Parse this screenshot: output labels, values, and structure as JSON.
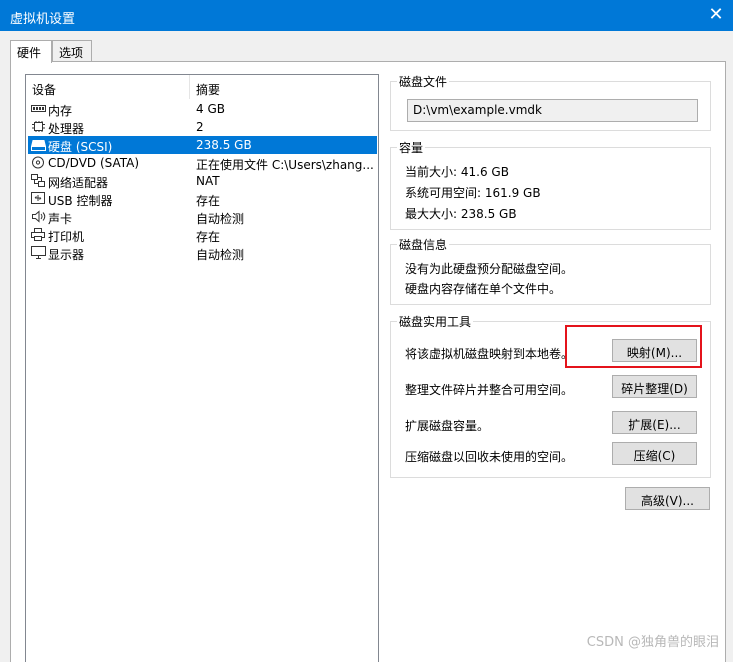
{
  "window": {
    "title": "虚拟机设置",
    "close_glyph": "✕"
  },
  "tabs": [
    {
      "label": "硬件",
      "active": true
    },
    {
      "label": "选项",
      "active": false
    }
  ],
  "device_list": {
    "col_device": "设备",
    "col_summary": "摘要",
    "rows": [
      {
        "name": "内存",
        "summary": "4 GB",
        "icon": "memory-icon"
      },
      {
        "name": "处理器",
        "summary": "2",
        "icon": "cpu-icon"
      },
      {
        "name": "硬盘 (SCSI)",
        "summary": "238.5 GB",
        "icon": "hard-disk-icon",
        "selected": true
      },
      {
        "name": "CD/DVD (SATA)",
        "summary": "正在使用文件 C:\\Users\\zhang...",
        "icon": "cd-dvd-icon"
      },
      {
        "name": "网络适配器",
        "summary": "NAT",
        "icon": "network-adapter-icon"
      },
      {
        "name": "USB 控制器",
        "summary": "存在",
        "icon": "usb-icon"
      },
      {
        "name": "声卡",
        "summary": "自动检测",
        "icon": "speaker-icon"
      },
      {
        "name": "打印机",
        "summary": "存在",
        "icon": "printer-icon"
      },
      {
        "name": "显示器",
        "summary": "自动检测",
        "icon": "monitor-icon"
      }
    ]
  },
  "disk_file": {
    "label": "磁盘文件",
    "value": "D:\\vm\\example.vmdk"
  },
  "capacity": {
    "label": "容量",
    "current": "当前大小: 41.6 GB",
    "free": "系统可用空间: 161.9 GB",
    "max": "最大大小: 238.5 GB"
  },
  "disk_info": {
    "label": "磁盘信息",
    "line1": "没有为此硬盘预分配磁盘空间。",
    "line2": "硬盘内容存储在单个文件中。"
  },
  "utilities": {
    "label": "磁盘实用工具",
    "map_text": "将该虚拟机磁盘映射到本地卷。",
    "map_button": "映射(M)...",
    "defrag_text": "整理文件碎片并整合可用空间。",
    "defrag_button": "碎片整理(D)",
    "expand_text": "扩展磁盘容量。",
    "expand_button": "扩展(E)...",
    "compact_text": "压缩磁盘以回收未使用的空间。",
    "compact_button": "压缩(C)"
  },
  "advanced_button": "高级(V)...",
  "watermark": "CSDN @独角兽的眼泪",
  "colors": {
    "accent": "#0078d7",
    "highlight": "#e4131b"
  }
}
